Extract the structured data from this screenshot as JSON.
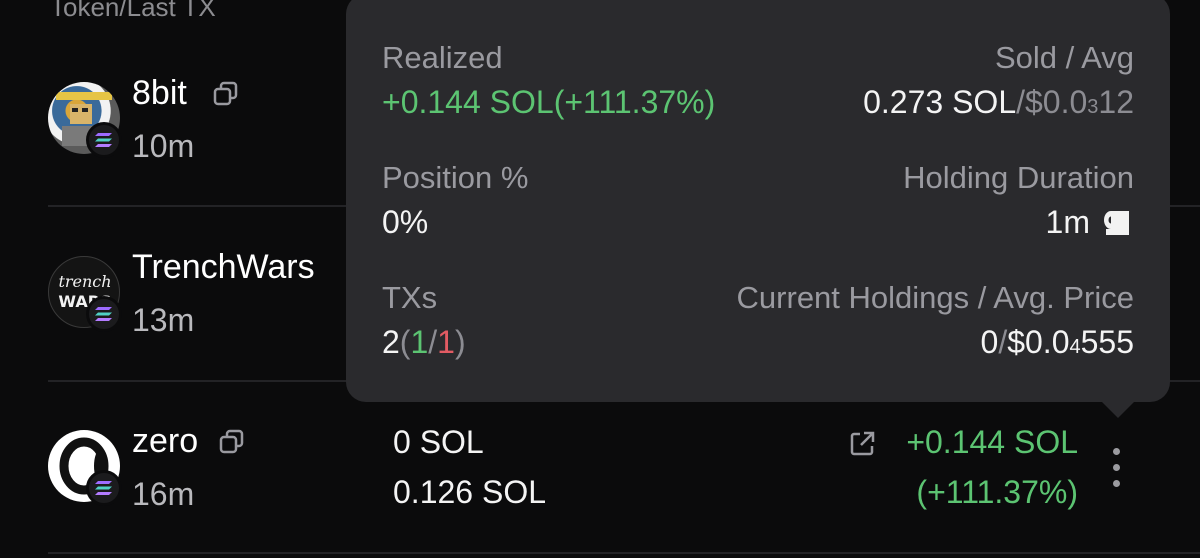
{
  "header": {
    "title": "Token/Last TX"
  },
  "rows": [
    {
      "name": "8bit",
      "time": "10m"
    },
    {
      "name": "TrenchWars",
      "time": "13m"
    },
    {
      "name": "zero",
      "time": "16m",
      "bought": "0 SOL",
      "sold": "0.126 SOL",
      "pnl_value": "+0.144 SOL",
      "pnl_percent": "(+111.37%)"
    }
  ],
  "tooltip": {
    "realized_label": "Realized",
    "realized_value": "+0.144 SOL(+111.37%)",
    "sold_avg_label": "Sold / Avg",
    "sold_amount": "0.273 SOL",
    "sold_sep": "/",
    "avg_price_prefix": "$0.0",
    "avg_price_sub": "3",
    "avg_price_suffix": "12",
    "position_label": "Position %",
    "position_value": "0%",
    "holding_label": "Holding Duration",
    "holding_value": "1m",
    "txs_label": "TXs",
    "txs_total": "2",
    "txs_open": "(",
    "txs_buys": "1",
    "txs_sep": "/",
    "txs_sells": "1",
    "txs_close": ")",
    "current_label": "Current Holdings / Avg. Price",
    "current_holdings": "0",
    "current_sep": "/",
    "current_price_prefix": "$0.0",
    "current_price_sub": "4",
    "current_price_suffix": "555"
  },
  "colors": {
    "positive": "#5cc472",
    "negative": "#e25b63",
    "tooltip_bg": "#2a2a2d",
    "background": "#0b0b0c"
  },
  "icons": {
    "copy": "copy-icon",
    "solana": "solana-icon",
    "external": "external-link-icon",
    "more": "more-vertical-icon",
    "duration": "toilet-paper-icon"
  }
}
